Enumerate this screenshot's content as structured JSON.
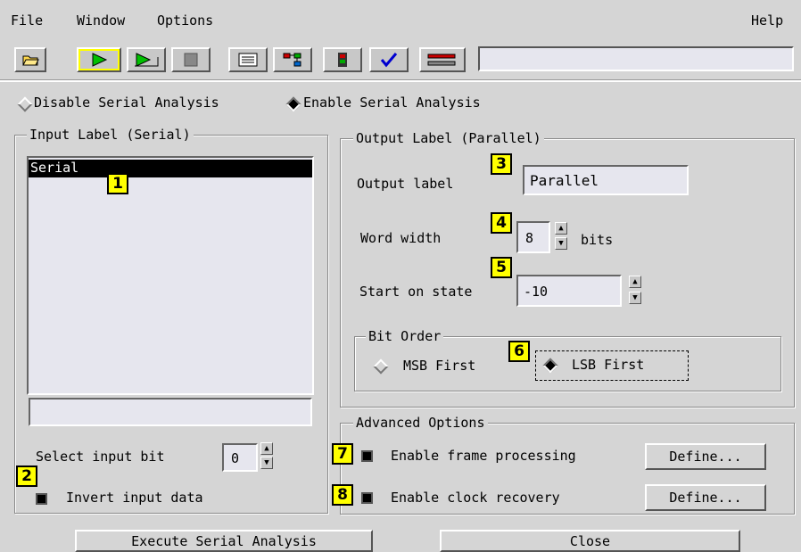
{
  "menu": {
    "file": "File",
    "window": "Window",
    "options": "Options",
    "help": "Help"
  },
  "toolbar": {
    "icons": [
      "open-folder-icon",
      "run-single-icon",
      "run-repetitive-icon",
      "stop-icon",
      "listing-icon",
      "overview-icon",
      "module-icon",
      "checkmark-icon",
      "tools-icon"
    ],
    "status_text": ""
  },
  "mode": {
    "disable_label": "Disable Serial Analysis",
    "enable_label": "Enable Serial Analysis",
    "selected": "enable"
  },
  "input_group": {
    "title": "Input Label (Serial)",
    "items": [
      "Serial"
    ],
    "selected_index": 0,
    "field_value": "",
    "select_bit_label": "Select input bit",
    "select_bit_value": "0",
    "invert_label": "Invert input data"
  },
  "output_group": {
    "title": "Output Label (Parallel)",
    "output_label_label": "Output label",
    "output_label_value": "Parallel",
    "word_width_label": "Word width",
    "word_width_value": "8",
    "bits_label": "bits",
    "start_state_label": "Start on state",
    "start_state_value": "-10",
    "bit_order": {
      "title": "Bit Order",
      "msb_label": "MSB First",
      "lsb_label": "LSB First",
      "selected": "lsb"
    }
  },
  "advanced": {
    "title": "Advanced Options",
    "frame_label": "Enable frame processing",
    "clock_label": "Enable clock recovery",
    "define_label": "Define..."
  },
  "callouts": [
    "1",
    "2",
    "3",
    "4",
    "5",
    "6",
    "7",
    "8"
  ],
  "footer": {
    "execute_label": "Execute Serial Analysis",
    "close_label": "Close"
  },
  "colors": {
    "background": "#d5d5d5",
    "callout": "#ffff00",
    "field": "#e6e6ee",
    "selection": "#000000"
  }
}
